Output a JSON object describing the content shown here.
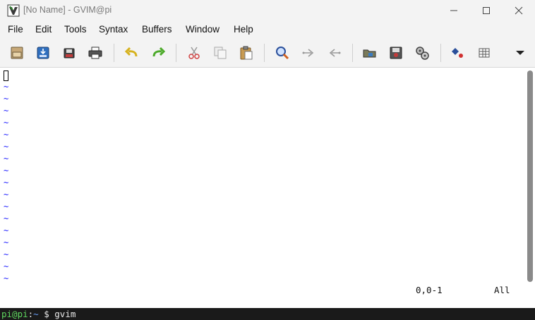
{
  "window": {
    "title": "[No Name] - GVIM@pi",
    "app_icon": "gvim-logo-icon",
    "controls": {
      "minimize_icon": "minimize-icon",
      "maximize_icon": "maximize-icon",
      "close_icon": "close-icon"
    }
  },
  "menubar": {
    "items": [
      {
        "label": "File"
      },
      {
        "label": "Edit"
      },
      {
        "label": "Tools"
      },
      {
        "label": "Syntax"
      },
      {
        "label": "Buffers"
      },
      {
        "label": "Window"
      },
      {
        "label": "Help"
      }
    ]
  },
  "toolbar": {
    "buttons": [
      {
        "icon": "open-file-icon"
      },
      {
        "icon": "save-icon"
      },
      {
        "icon": "save-all-icon"
      },
      {
        "icon": "print-icon"
      },
      {
        "icon": "undo-icon"
      },
      {
        "icon": "redo-icon"
      },
      {
        "icon": "cut-icon"
      },
      {
        "icon": "copy-icon"
      },
      {
        "icon": "paste-icon"
      },
      {
        "icon": "find-replace-icon"
      },
      {
        "icon": "find-next-icon"
      },
      {
        "icon": "find-previous-icon"
      },
      {
        "icon": "load-session-icon"
      },
      {
        "icon": "save-session-icon"
      },
      {
        "icon": "run-script-icon"
      },
      {
        "icon": "make-icon"
      },
      {
        "icon": "tags-table-icon"
      },
      {
        "icon": "overflow-dropdown-icon"
      }
    ]
  },
  "editor": {
    "empty_line_marker": "~",
    "status_position": "0,0-1",
    "status_scroll": "All"
  },
  "terminal": {
    "user_host": "pi@pi",
    "separator": ":",
    "cwd": "~",
    "prompt": " $ ",
    "command": "gvim"
  },
  "colors": {
    "tilde": "#2020ff",
    "prompt_user": "#5fd75f",
    "prompt_path": "#6aa3ff"
  }
}
